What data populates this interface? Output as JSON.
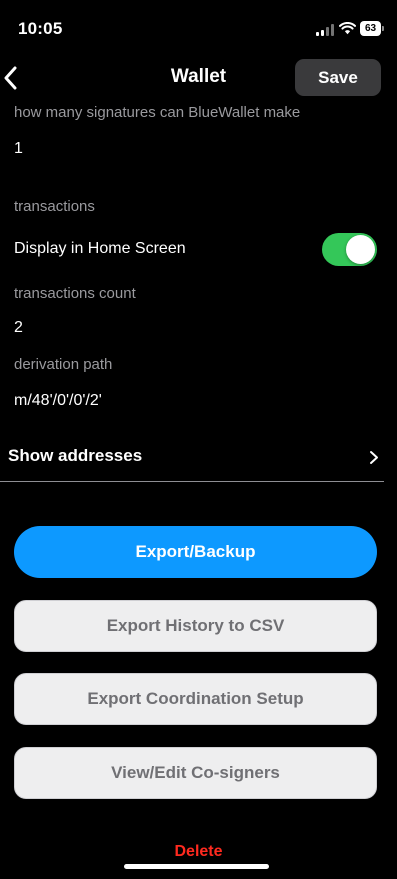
{
  "status_bar": {
    "time": "10:05",
    "battery": "63"
  },
  "nav": {
    "title": "Wallet",
    "save_label": "Save"
  },
  "fields": {
    "signatures_label": "how many signatures can BlueWallet make",
    "signatures_value": "1",
    "transactions_label": "transactions",
    "display_home_label": "Display in Home Screen",
    "display_home_on": true,
    "tx_count_label": "transactions count",
    "tx_count_value": "2",
    "derivation_label": "derivation path",
    "derivation_value": "m/48'/0'/0'/2'"
  },
  "show_addresses": {
    "label": "Show addresses"
  },
  "buttons": {
    "export_backup": "Export/Backup",
    "export_history": "Export History to CSV",
    "export_coordination": "Export Coordination Setup",
    "view_edit_cosigners": "View/Edit Co-signers",
    "delete": "Delete"
  },
  "colors": {
    "accent": "#0d99ff",
    "toggle_on": "#34c759",
    "destructive": "#ff2a1f",
    "background": "#000000"
  },
  "icons": [
    "back-chevron-icon",
    "chevron-right-icon",
    "signal-icon",
    "wifi-icon",
    "battery-icon"
  ]
}
